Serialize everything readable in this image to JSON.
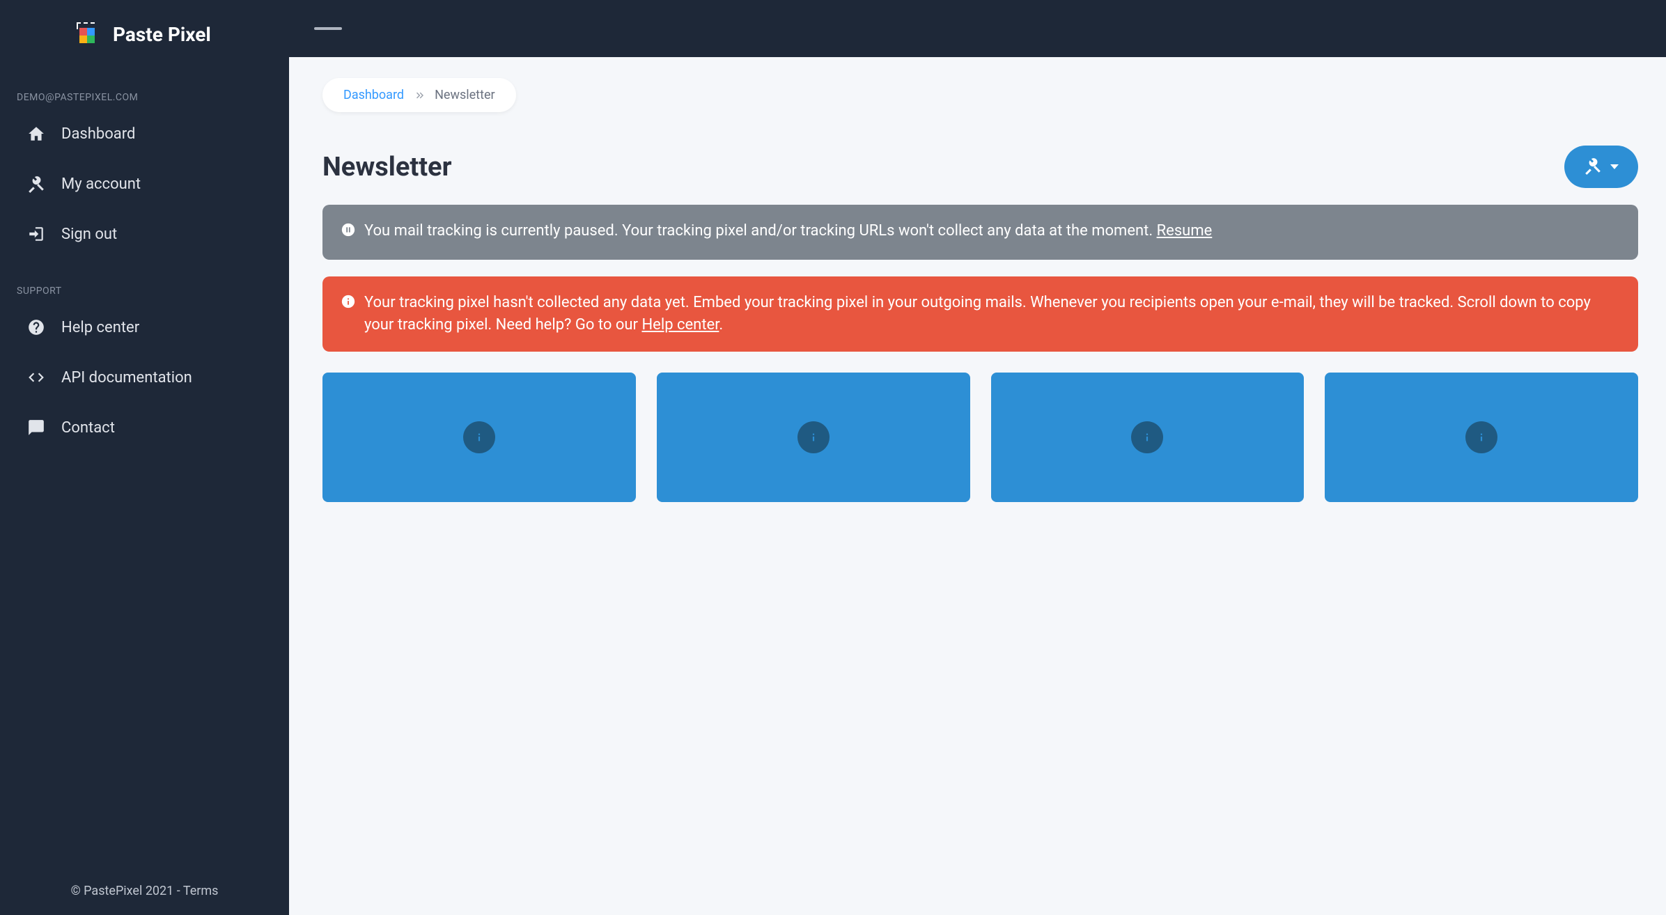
{
  "brand": {
    "name": "Paste Pixel"
  },
  "user_email": "DEMO@PASTEPIXEL.COM",
  "nav": {
    "main": [
      {
        "label": "Dashboard",
        "icon": "home-icon"
      },
      {
        "label": "My account",
        "icon": "tools-icon"
      },
      {
        "label": "Sign out",
        "icon": "signout-icon"
      }
    ],
    "support_label": "SUPPORT",
    "support": [
      {
        "label": "Help center",
        "icon": "question-icon"
      },
      {
        "label": "API documentation",
        "icon": "code-icon"
      },
      {
        "label": "Contact",
        "icon": "chat-icon"
      }
    ]
  },
  "footer": {
    "copyright": "© PastePixel 2021 - ",
    "terms": "Terms"
  },
  "breadcrumb": {
    "root": "Dashboard",
    "current": "Newsletter"
  },
  "page": {
    "title": "Newsletter"
  },
  "alerts": {
    "paused": {
      "text": "You mail tracking is currently paused. Your tracking pixel and/or tracking URLs won't collect any data at the moment. ",
      "link": "Resume"
    },
    "nodata": {
      "text": "Your tracking pixel hasn't collected any data yet. Embed your tracking pixel in your outgoing mails. Whenever you recipients open your e-mail, they will be tracked. Scroll down to copy your tracking pixel. Need help? Go to our ",
      "link": "Help center",
      "suffix": "."
    }
  }
}
